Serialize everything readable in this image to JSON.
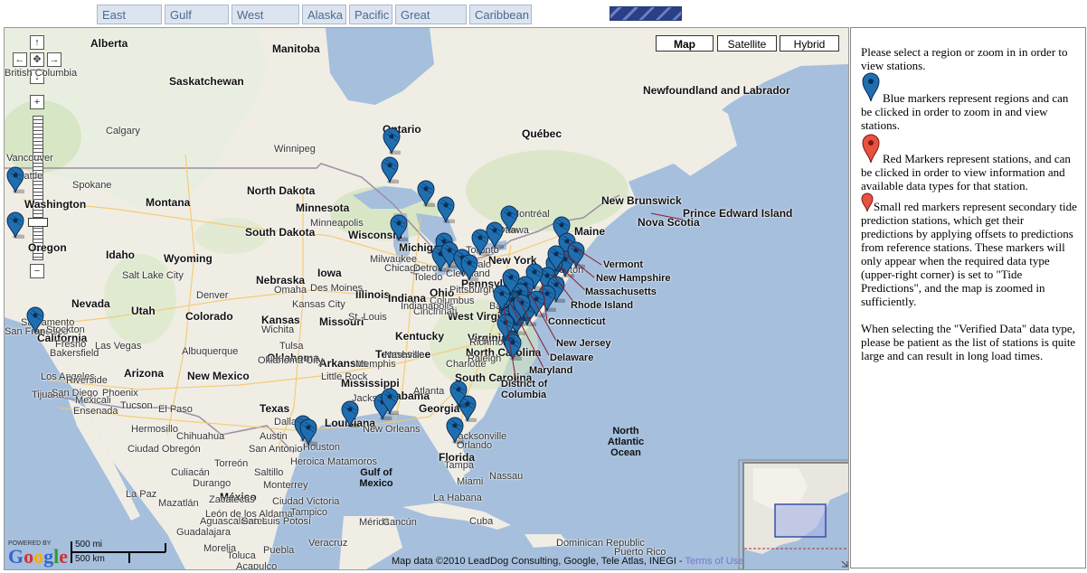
{
  "tabs": [
    "East Coast",
    "Gulf Coast",
    "West Coast",
    "Alaska",
    "Pacific",
    "Great Lakes",
    "Caribbean"
  ],
  "map_types": [
    "Map",
    "Satellite",
    "Hybrid"
  ],
  "map_type_selected": "Map",
  "map_labels": {
    "places": [
      "Alberta",
      "Manitoba",
      "British Columbia",
      "Saskatchewan",
      "Ontario",
      "Québec",
      "Newfoundland and Labrador",
      "Calgary",
      "Winnipeg",
      "Vancouver",
      "Seattle",
      "Spokane",
      "Washington",
      "Montana",
      "North Dakota",
      "Minnesota",
      "Minneapolis",
      "Wisconsin",
      "Michigan",
      "South Dakota",
      "Oregon",
      "Idaho",
      "Wyoming",
      "Nebraska",
      "Iowa",
      "Illinois",
      "Indiana",
      "Ohio",
      "Pennsylvania",
      "New York",
      "Montréal",
      "Ottawa",
      "Toronto",
      "Québec",
      "New Brunswick",
      "Nova Scotia",
      "Prince Edward Island",
      "Maine",
      "Nevada",
      "Utah",
      "Colorado",
      "Kansas",
      "Missouri",
      "Kentucky",
      "West Virginia",
      "Virginia",
      "North Carolina",
      "South Carolina",
      "Tennessee",
      "Georgia",
      "Alabama",
      "Mississippi",
      "Louisiana",
      "Arkansas",
      "Oklahoma",
      "Texas",
      "New Mexico",
      "Arizona",
      "California",
      "San Francisco",
      "Las Vegas",
      "Los Angeles",
      "Tijuana",
      "Houston",
      "Dallas",
      "Florida",
      "Chicago",
      "Detroit",
      "Toledo",
      "Cleveland",
      "Cincinnati",
      "Milwaukee",
      "Salt Lake City",
      "Denver",
      "Phoenix",
      "Tucson",
      "Hermosillo",
      "Chihuahua",
      "Monterrey",
      "México",
      "Guadalajara",
      "La Paz",
      "Mazatlán",
      "Culiacán",
      "Ciudad Obregón",
      "Heroica Matamoros",
      "Ensenada",
      "Mérida",
      "Cancún",
      "La Habana",
      "Cuba",
      "Dominican Republic",
      "Puerto Rico",
      "Nassau",
      "Miami",
      "Tampa",
      "Orlando",
      "Jacksonville",
      "Atlanta",
      "Memphis",
      "Nashville",
      "Charlotte",
      "Raleigh",
      "Richmond",
      "Baltimore",
      "Boston",
      "Buffalo",
      "Pittsburgh",
      "Columbus",
      "Indianapolis",
      "St. Louis",
      "Kansas City",
      "Omaha",
      "Des Moines",
      "Wichita",
      "Tulsa",
      "Oklahoma City",
      "Little Rock",
      "Jackson",
      "New Orleans",
      "San Antonio",
      "Austin",
      "El Paso",
      "Albuquerque",
      "Sacramento",
      "Stockton",
      "Fresno",
      "Bakersfield",
      "Riverside",
      "San Diego",
      "Mexicali",
      "Veracruz",
      "Puebla",
      "Acapulco",
      "Morelia",
      "Toluca",
      "Aguascalientes",
      "León de los Aldama",
      "San Luis Potosí",
      "Torreón",
      "Saltillo",
      "Ciudad Victoria",
      "Tampico",
      "Durango",
      "Zacatecas"
    ],
    "seas": [
      "Gulf of Mexico",
      "North Atlantic Ocean"
    ],
    "callouts": [
      "Vermont",
      "New Hampshire",
      "Massachusetts",
      "Rhode Island",
      "Connecticut",
      "New Jersey",
      "Delaware",
      "Maryland",
      "District of Columbia"
    ]
  },
  "attribution": "Map data ©2010 LeadDog Consulting, Google, Tele Atlas, INEGI -",
  "terms_link": "Terms of Use",
  "logo": {
    "powered_by": "POWERED BY",
    "word": "Google"
  },
  "scale": {
    "miles": "500 mi",
    "km": "500 km"
  },
  "markers": {
    "region_count": 49,
    "color_region": "#1f6fb0",
    "color_station": "#e85040"
  },
  "panel": {
    "intro": "Please select a region or zoom in in order to view stations.",
    "blue": "Blue markers represent regions and can be clicked in order to zoom in and view stations.",
    "red": "Red Markers represent stations, and can be clicked in order to view information and available data types for that station.",
    "small_red": "Small red markers represent secondary tide prediction stations, which get their predictions by applying offsets to predictions from reference stations. These markers will only appear when the required data type (upper-right corner) is set to \"Tide Predictions\", and the map is zoomed in sufficiently.",
    "verified": "When selecting the \"Verified Data\" data type, please be patient as the list of stations is quite large and can result in long load times."
  }
}
